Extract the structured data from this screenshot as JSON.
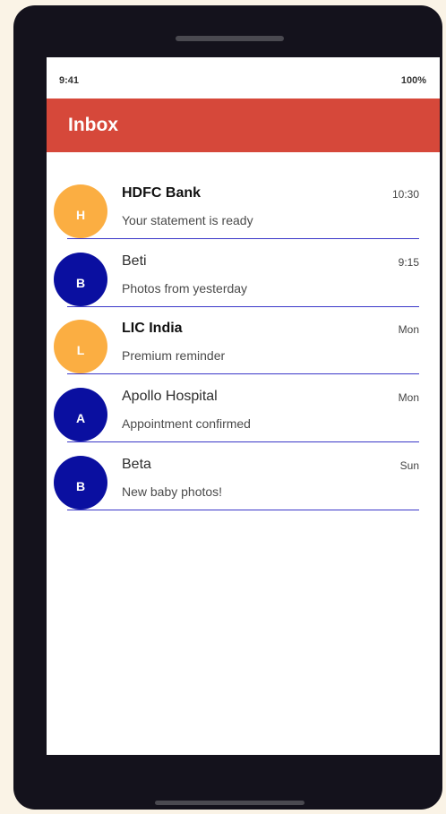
{
  "status_bar": {
    "time": "9:41",
    "battery": "100%"
  },
  "app_bar": {
    "title": "Inbox"
  },
  "colors": {
    "app_bar": "#d6483a",
    "avatar_orange": "#fbae42",
    "avatar_blue": "#0a0fa0",
    "divider": "#3a37c8"
  },
  "messages": [
    {
      "initial": "H",
      "sender": "HDFC Bank",
      "time": "10:30",
      "preview": "Your statement is ready",
      "unread": true,
      "avatar_color": "#fbae42"
    },
    {
      "initial": "B",
      "sender": "Beti",
      "time": "9:15",
      "preview": "Photos from yesterday",
      "unread": false,
      "avatar_color": "#0a0fa0"
    },
    {
      "initial": "L",
      "sender": "LIC India",
      "time": "Mon",
      "preview": "Premium reminder",
      "unread": true,
      "avatar_color": "#fbae42"
    },
    {
      "initial": "A",
      "sender": "Apollo Hospital",
      "time": "Mon",
      "preview": "Appointment confirmed",
      "unread": false,
      "avatar_color": "#0a0fa0"
    },
    {
      "initial": "B",
      "sender": "Beta",
      "time": "Sun",
      "preview": "New baby photos!",
      "unread": false,
      "avatar_color": "#0a0fa0"
    }
  ]
}
